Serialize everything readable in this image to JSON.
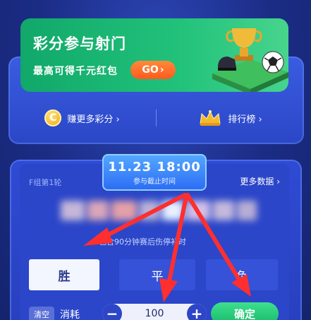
{
  "promo": {
    "title": "彩分参与射门",
    "subtitle": "最高可得千元红包",
    "go_label": "GO",
    "go_arrow": "›"
  },
  "links": {
    "coin_glyph": "C",
    "earn_label": "赚更多彩分 ›",
    "rank_label": "排行榜 ›"
  },
  "match": {
    "group_round": "F组第1轮",
    "more_data": "更多数据 ›",
    "time": "11.23 18:00",
    "deadline_label": "参与截止时间",
    "note": "包含90分钟赛后伤停补时",
    "options": [
      "胜",
      "平",
      "负"
    ],
    "selected_option": "胜"
  },
  "bet": {
    "clear_label": "清空",
    "consume_label": "消耗",
    "minus": "−",
    "amount": "100",
    "plus": "+",
    "confirm_label": "确定"
  },
  "colors": {
    "background": "#1c2f86",
    "promo_green": "#22c27b",
    "go_orange": "#ff6a2a",
    "panel_blue": "#2f4ad4",
    "arrow_red": "#ff3333",
    "confirm_green": "#19b86a"
  },
  "icons": [
    "coin-icon",
    "crown-icon",
    "trophy-icon",
    "soccer-ball-icon",
    "chevron-right-icon"
  ]
}
